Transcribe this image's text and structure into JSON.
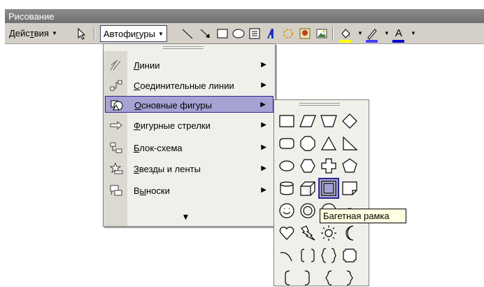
{
  "window": {
    "title": "Рисование"
  },
  "toolbar": {
    "actions_label": "Действия",
    "actions_underline": "т",
    "autoshapes_label": "Автофигуры",
    "autoshapes_underline": "у"
  },
  "menu": {
    "items": [
      {
        "label": "Линии",
        "accel": "Л",
        "rest": "инии",
        "icon": "lines-icon"
      },
      {
        "label": "Соединительные линии",
        "accel": "С",
        "rest": "оединительные линии",
        "icon": "connectors-icon"
      },
      {
        "label": "Основные фигуры",
        "accel": "О",
        "rest": "сновные фигуры",
        "icon": "basic-shapes-icon",
        "selected": true
      },
      {
        "label": "Фигурные стрелки",
        "accel": "Ф",
        "rest": "игурные стрелки",
        "icon": "block-arrows-icon"
      },
      {
        "label": "Блок-схема",
        "accel": "Б",
        "rest": "лок-схема",
        "icon": "flowchart-icon"
      },
      {
        "label": "Звезды и ленты",
        "accel": "З",
        "rest": "везды и ленты",
        "icon": "stars-banners-icon"
      },
      {
        "label": "Выноски",
        "accel": "ы",
        "pre": "В",
        "rest": "носки",
        "icon": "callouts-icon"
      }
    ],
    "expand_glyph": "»"
  },
  "palette": {
    "shapes": [
      "rectangle",
      "parallelogram",
      "trapezoid",
      "diamond",
      "rounded-rectangle",
      "octagon",
      "isosceles-triangle",
      "right-triangle",
      "oval",
      "hexagon",
      "cross",
      "pentagon",
      "can",
      "cube",
      "frame",
      "folded-corner",
      "smiley-face",
      "donut",
      "no-symbol",
      "block-arc",
      "heart",
      "lightning-bolt",
      "sun",
      "moon",
      "arc",
      "double-bracket",
      "double-brace",
      "plaque",
      "left-bracket",
      "right-bracket",
      "left-brace",
      "right-brace"
    ],
    "highlighted": "frame"
  },
  "tooltip": {
    "text": "Багетная рамка"
  },
  "colors": {
    "selection": "#a6a2d4",
    "selection_border": "#2b2b8a",
    "fill_bar": "#ffff00",
    "line_bar": "#4040ff",
    "font_bar": "#0000cc"
  }
}
